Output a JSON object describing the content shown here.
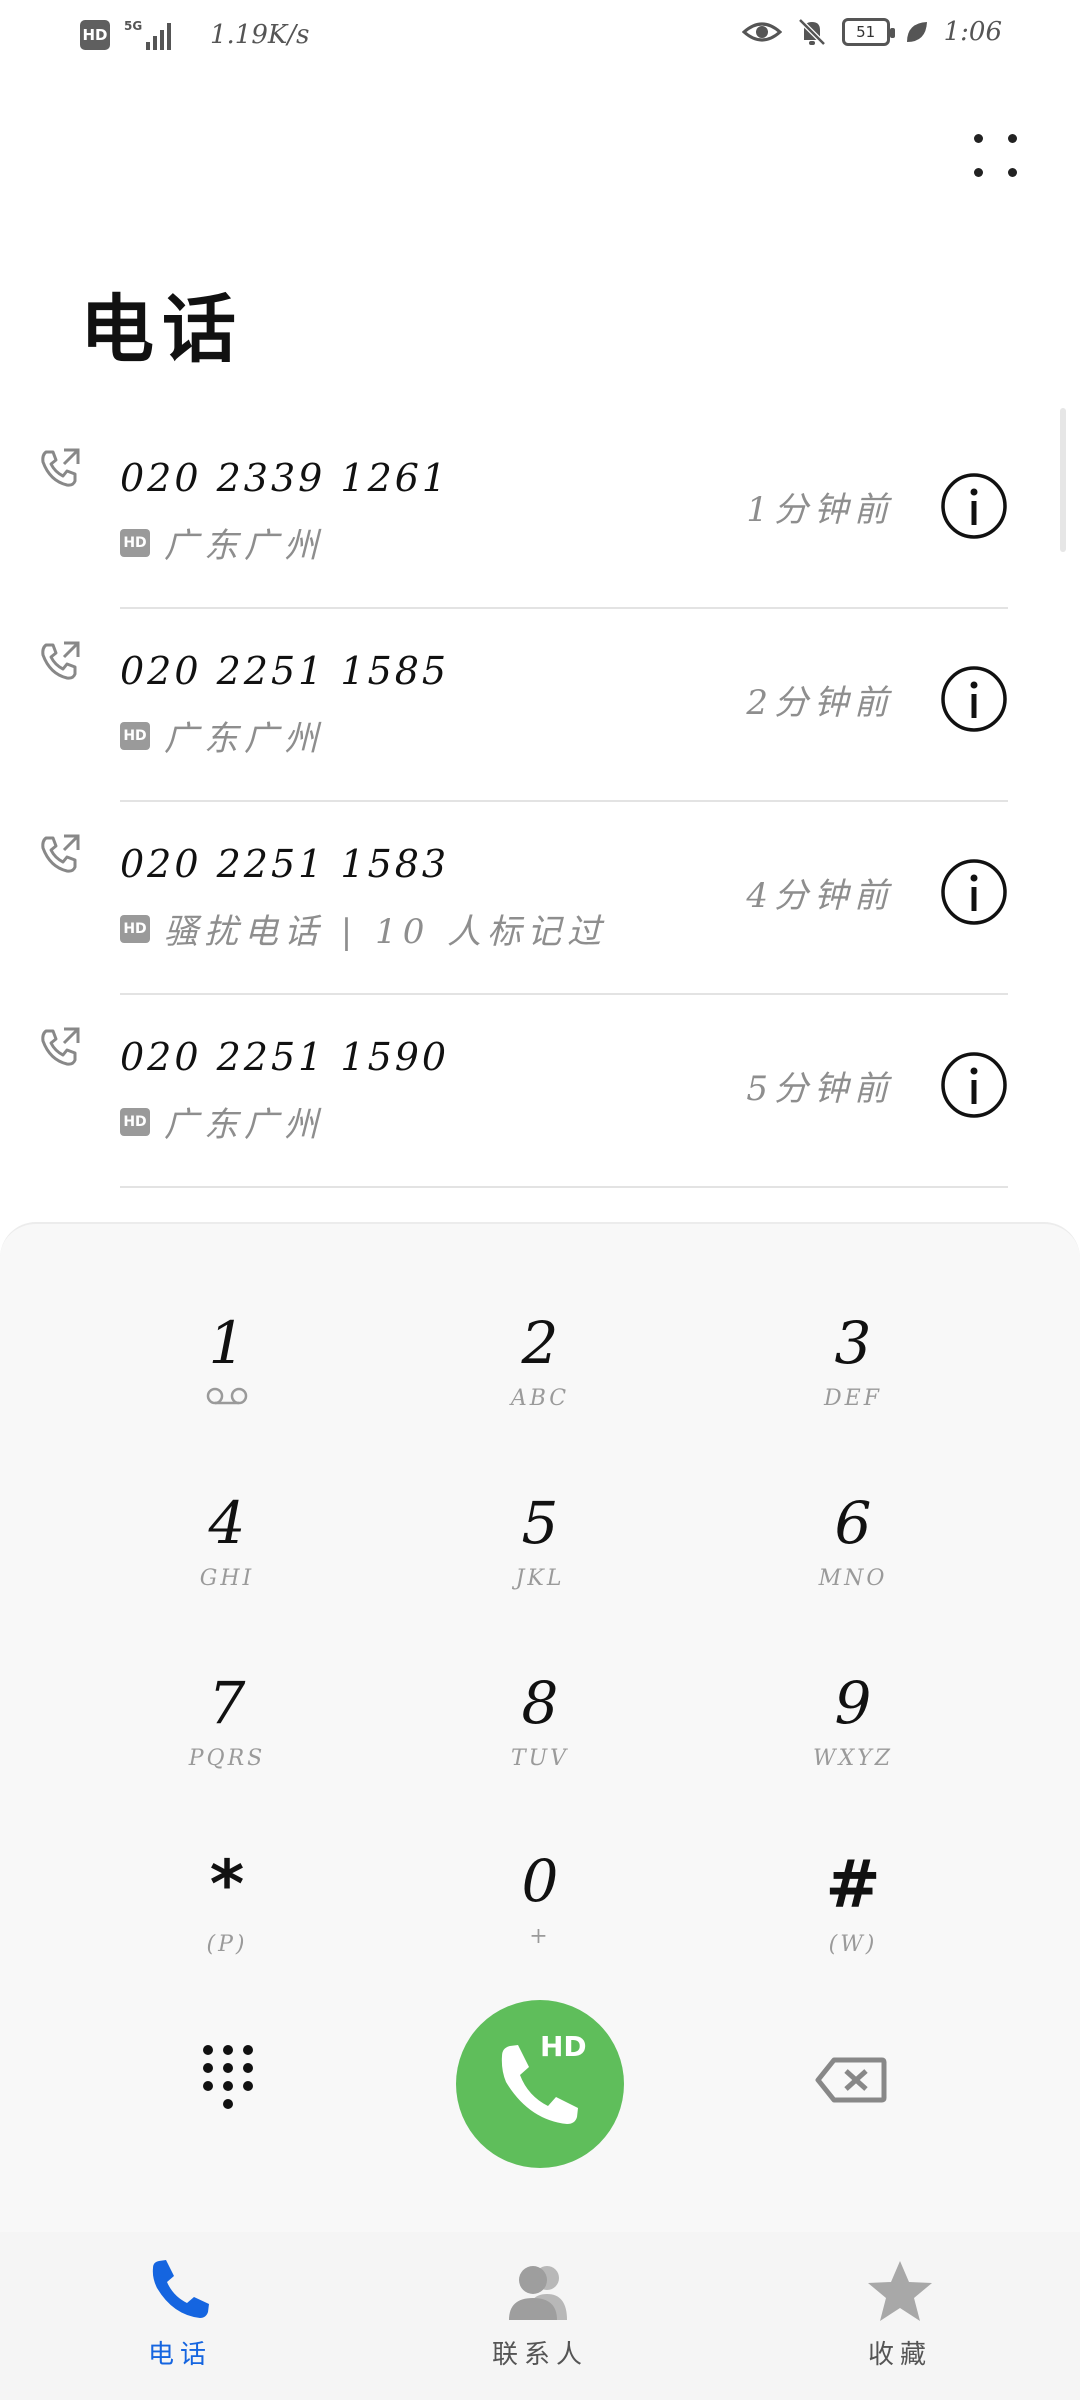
{
  "status_bar": {
    "hd_indicator": "HD",
    "signal_label": "5G",
    "network_speed": "1.19K/s",
    "battery_level": "51",
    "time": "1:06"
  },
  "header": {
    "title": "电话",
    "more_icon": "more-dots-icon"
  },
  "call_log": [
    {
      "number": "020 2339 1261",
      "badge": "HD",
      "location": "广东广州",
      "time": "1分钟前"
    },
    {
      "number": "020 2251 1585",
      "badge": "HD",
      "location": "广东广州",
      "time": "2分钟前"
    },
    {
      "number": "020 2251 1583",
      "badge": "HD",
      "location": "骚扰电话 | 10 人标记过",
      "time": "4分钟前"
    },
    {
      "number": "020 2251 1590",
      "badge": "HD",
      "location": "广东广州",
      "time": "5分钟前"
    }
  ],
  "dialpad": {
    "keys": [
      {
        "digit": "1",
        "letters": ""
      },
      {
        "digit": "2",
        "letters": "ABC"
      },
      {
        "digit": "3",
        "letters": "DEF"
      },
      {
        "digit": "4",
        "letters": "GHI"
      },
      {
        "digit": "5",
        "letters": "JKL"
      },
      {
        "digit": "6",
        "letters": "MNO"
      },
      {
        "digit": "7",
        "letters": "PQRS"
      },
      {
        "digit": "8",
        "letters": "TUV"
      },
      {
        "digit": "9",
        "letters": "WXYZ"
      },
      {
        "digit": "*",
        "letters": "(P)"
      },
      {
        "digit": "0",
        "letters": "+"
      },
      {
        "digit": "#",
        "letters": "(W)"
      }
    ],
    "call_button_badge": "HD",
    "call_button_color": "#5fbe5b"
  },
  "bottom_nav": {
    "items": [
      {
        "label": "电话",
        "icon": "phone-icon",
        "active": true
      },
      {
        "label": "联系人",
        "icon": "contacts-icon",
        "active": false
      },
      {
        "label": "收藏",
        "icon": "star-icon",
        "active": false
      }
    ],
    "active_color": "#1565e0"
  }
}
